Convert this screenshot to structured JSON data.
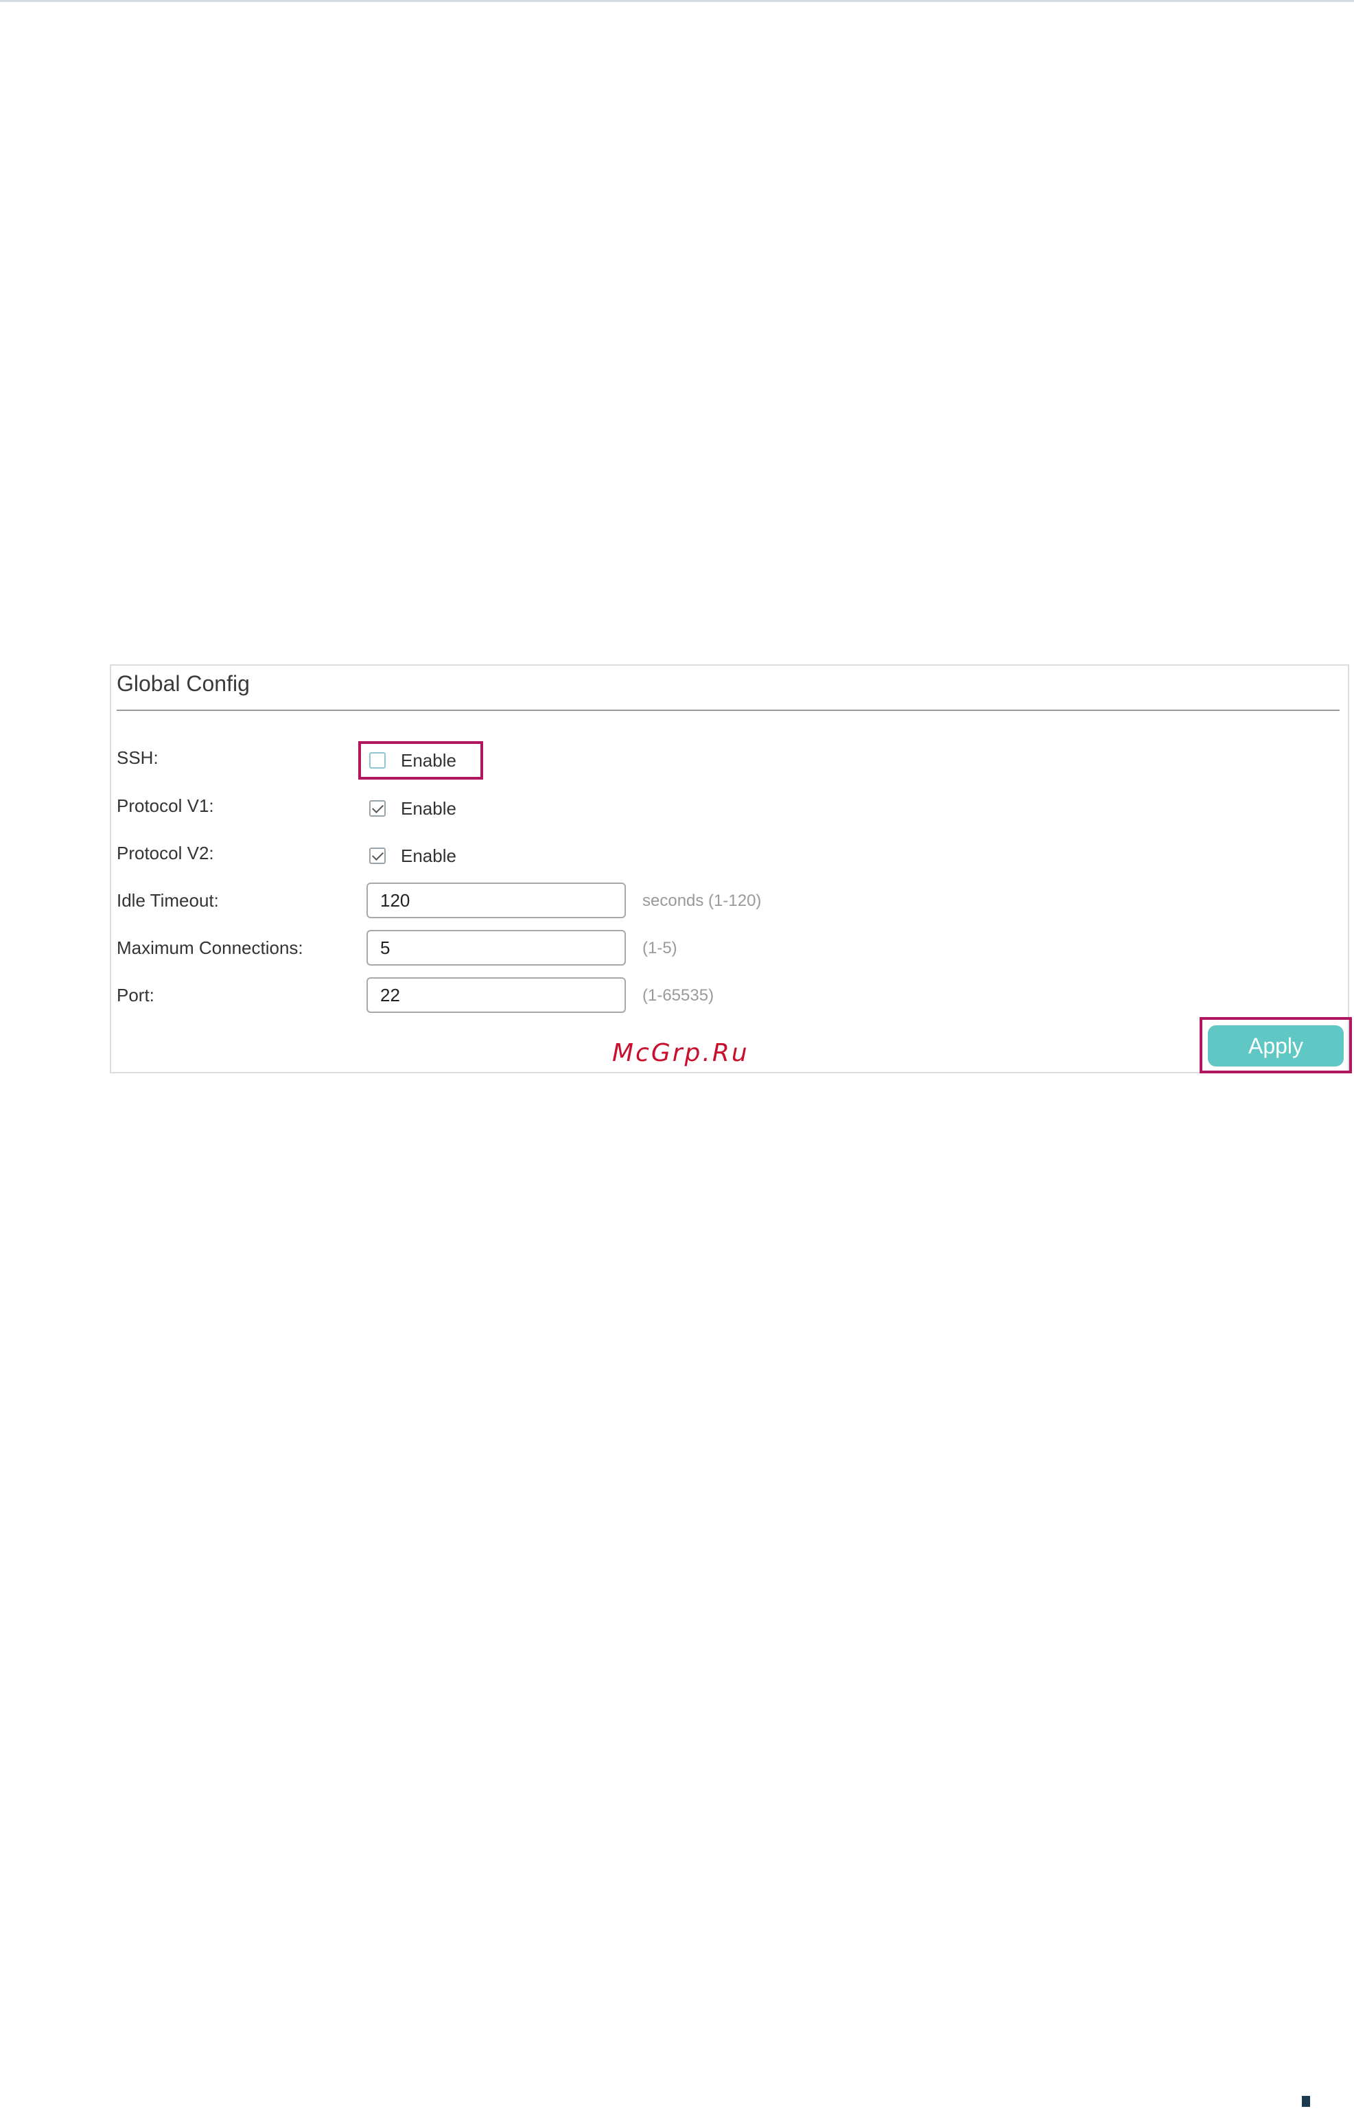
{
  "panel": {
    "title": "Global Config"
  },
  "rows": {
    "ssh": {
      "label": "SSH:",
      "option_label": "Enable",
      "checked": false
    },
    "protocol_v1": {
      "label": "Protocol V1:",
      "option_label": "Enable",
      "checked": true
    },
    "protocol_v2": {
      "label": "Protocol V2:",
      "option_label": "Enable",
      "checked": true
    },
    "idle_timeout": {
      "label": "Idle Timeout:",
      "value": "120",
      "hint": "seconds (1-120)"
    },
    "max_connections": {
      "label": "Maximum Connections:",
      "value": "5",
      "hint": "(1-5)"
    },
    "port": {
      "label": "Port:",
      "value": "22",
      "hint": "(1-65535)"
    }
  },
  "actions": {
    "apply_label": "Apply"
  },
  "watermark": "McGrp.Ru",
  "colors": {
    "highlight": "#b1175f",
    "apply_button": "#5fc7c4",
    "watermark": "#c8102e"
  }
}
